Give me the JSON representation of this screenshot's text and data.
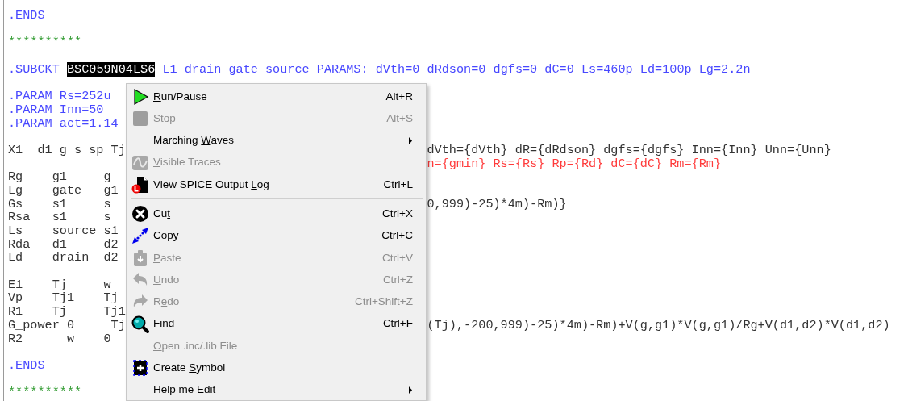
{
  "editor": {
    "lines": [
      {
        "kind": "code",
        "left": [
          {
            "text": ".ENDS",
            "kind": "directive"
          }
        ]
      },
      {
        "kind": "blank"
      },
      {
        "kind": "code",
        "left": [
          {
            "text": "**********",
            "kind": "comment"
          }
        ]
      },
      {
        "kind": "blank"
      },
      {
        "kind": "code",
        "left": [
          {
            "text": ".SUBCKT ",
            "kind": "directive"
          },
          {
            "text": "BSC059N04LS6",
            "kind": "selected"
          },
          {
            "text": " L1 drain gate source PARAMS: dVth=0 dRdson=0 dgfs=0 dC=0 Ls=460p Ld=100p Lg=2.2n",
            "kind": "directive"
          }
        ]
      },
      {
        "kind": "blank"
      },
      {
        "kind": "code",
        "left": [
          {
            "text": ".PARAM Rs=252u",
            "kind": "directive"
          }
        ]
      },
      {
        "kind": "code",
        "left": [
          {
            "text": ".PARAM Inn=50",
            "kind": "directive"
          }
        ]
      },
      {
        "kind": "code",
        "left": [
          {
            "text": ".PARAM act=1.14",
            "kind": "directive"
          }
        ]
      },
      {
        "kind": "blank"
      },
      {
        "kind": "code",
        "left": [
          {
            "text": "X1  d1 g s sp Tj",
            "kind": "plain"
          }
        ],
        "right": [
          {
            "text": "dVth={dVth} dR={dRdson} dgfs={dgfs} Inn={Inn} Unn={Unn}",
            "kind": "plain"
          }
        ]
      },
      {
        "kind": "code",
        "right": [
          {
            "text": "n={gmin} Rs={Rs} Rp={Rd} dC={dC} Rm={Rm}",
            "kind": "param"
          }
        ]
      },
      {
        "kind": "code",
        "left": [
          {
            "text": "Rg    g1     g",
            "kind": "plain"
          }
        ]
      },
      {
        "kind": "code",
        "left": [
          {
            "text": "Lg    gate   g1",
            "kind": "plain"
          }
        ]
      },
      {
        "kind": "code",
        "left": [
          {
            "text": "Gs    s1     s",
            "kind": "plain"
          }
        ],
        "right": [
          {
            "text": "0,999)-25)*4m)-Rm)}",
            "kind": "plain"
          }
        ]
      },
      {
        "kind": "code",
        "left": [
          {
            "text": "Rsa   s1     s",
            "kind": "plain"
          }
        ]
      },
      {
        "kind": "code",
        "left": [
          {
            "text": "Ls    source s1",
            "kind": "plain"
          }
        ]
      },
      {
        "kind": "code",
        "left": [
          {
            "text": "Rda   d1     d2",
            "kind": "plain"
          }
        ]
      },
      {
        "kind": "code",
        "left": [
          {
            "text": "Ld    drain  d2",
            "kind": "plain"
          }
        ]
      },
      {
        "kind": "blank"
      },
      {
        "kind": "code",
        "left": [
          {
            "text": "E1    Tj     w",
            "kind": "plain"
          }
        ]
      },
      {
        "kind": "code",
        "left": [
          {
            "text": "Vp    Tj1    Tj",
            "kind": "plain"
          }
        ]
      },
      {
        "kind": "code",
        "left": [
          {
            "text": "R1    Tj     Tj1",
            "kind": "plain"
          }
        ]
      },
      {
        "kind": "code",
        "left": [
          {
            "text": "G_power 0     Tj",
            "kind": "plain"
          }
        ],
        "right": [
          {
            "text": "(Tj),-200,999)-25)*4m)-Rm)+V(g,g1)*V(g,g1)/Rg+V(d1,d2)*V(d1,d2)",
            "kind": "plain"
          }
        ]
      },
      {
        "kind": "code",
        "left": [
          {
            "text": "R2      w    0",
            "kind": "plain"
          }
        ]
      },
      {
        "kind": "blank"
      },
      {
        "kind": "code",
        "left": [
          {
            "text": ".ENDS",
            "kind": "directive"
          }
        ]
      },
      {
        "kind": "blank"
      },
      {
        "kind": "code",
        "left": [
          {
            "text": "**********",
            "kind": "comment"
          }
        ]
      }
    ]
  },
  "context_menu": {
    "items": [
      {
        "kind": "play",
        "label": [
          {
            "text": "R",
            "access_key": true
          },
          {
            "text": "un/Pause",
            "access_key": false
          }
        ],
        "shortcut": "Alt+R",
        "disabled": false,
        "submenu": false
      },
      {
        "kind": "stop",
        "label": [
          {
            "text": "S",
            "access_key": true
          },
          {
            "text": "top",
            "access_key": false
          }
        ],
        "shortcut": "Alt+S",
        "disabled": true,
        "submenu": false
      },
      {
        "kind": "plain",
        "label": [
          {
            "text": "Marching ",
            "access_key": false
          },
          {
            "text": "W",
            "access_key": true
          },
          {
            "text": "aves",
            "access_key": false
          }
        ],
        "disabled": false,
        "submenu": true
      },
      {
        "kind": "wave",
        "label": [
          {
            "text": "V",
            "access_key": true
          },
          {
            "text": "isible Traces",
            "access_key": false
          }
        ],
        "disabled": true,
        "submenu": false
      },
      {
        "kind": "log",
        "label": [
          {
            "text": "View SPICE Output ",
            "access_key": false
          },
          {
            "text": "L",
            "access_key": true
          },
          {
            "text": "og",
            "access_key": false
          }
        ],
        "shortcut": "Ctrl+L",
        "disabled": false,
        "submenu": false
      },
      {
        "kind": "separator"
      },
      {
        "kind": "cut",
        "label": [
          {
            "text": "Cu",
            "access_key": false
          },
          {
            "text": "t",
            "access_key": true
          }
        ],
        "shortcut": "Ctrl+X",
        "disabled": false,
        "submenu": false
      },
      {
        "kind": "copy",
        "label": [
          {
            "text": "C",
            "access_key": true
          },
          {
            "text": "opy",
            "access_key": false
          }
        ],
        "shortcut": "Ctrl+C",
        "disabled": false,
        "submenu": false
      },
      {
        "kind": "paste",
        "label": [
          {
            "text": "P",
            "access_key": true
          },
          {
            "text": "aste",
            "access_key": false
          }
        ],
        "shortcut": "Ctrl+V",
        "disabled": true,
        "submenu": false
      },
      {
        "kind": "undo",
        "label": [
          {
            "text": "U",
            "access_key": true
          },
          {
            "text": "ndo",
            "access_key": false
          }
        ],
        "shortcut": "Ctrl+Z",
        "disabled": true,
        "submenu": false
      },
      {
        "kind": "redo",
        "label": [
          {
            "text": "R",
            "access_key": false
          },
          {
            "text": "e",
            "access_key": true
          },
          {
            "text": "do",
            "access_key": false
          }
        ],
        "shortcut": "Ctrl+Shift+Z",
        "disabled": true,
        "submenu": false
      },
      {
        "kind": "find",
        "label": [
          {
            "text": "F",
            "access_key": true
          },
          {
            "text": "ind",
            "access_key": false
          }
        ],
        "shortcut": "Ctrl+F",
        "disabled": false,
        "submenu": false
      },
      {
        "kind": "plain",
        "label": [
          {
            "text": "O",
            "access_key": true
          },
          {
            "text": "pen .inc/.lib File",
            "access_key": false
          }
        ],
        "disabled": true,
        "submenu": false
      },
      {
        "kind": "symbol",
        "label": [
          {
            "text": "Create ",
            "access_key": false
          },
          {
            "text": "S",
            "access_key": true
          },
          {
            "text": "ymbol",
            "access_key": false
          }
        ],
        "disabled": false,
        "submenu": false
      },
      {
        "kind": "plain",
        "label": [
          {
            "text": "Help me Edit",
            "access_key": false
          }
        ],
        "disabled": false,
        "submenu": true
      }
    ]
  }
}
